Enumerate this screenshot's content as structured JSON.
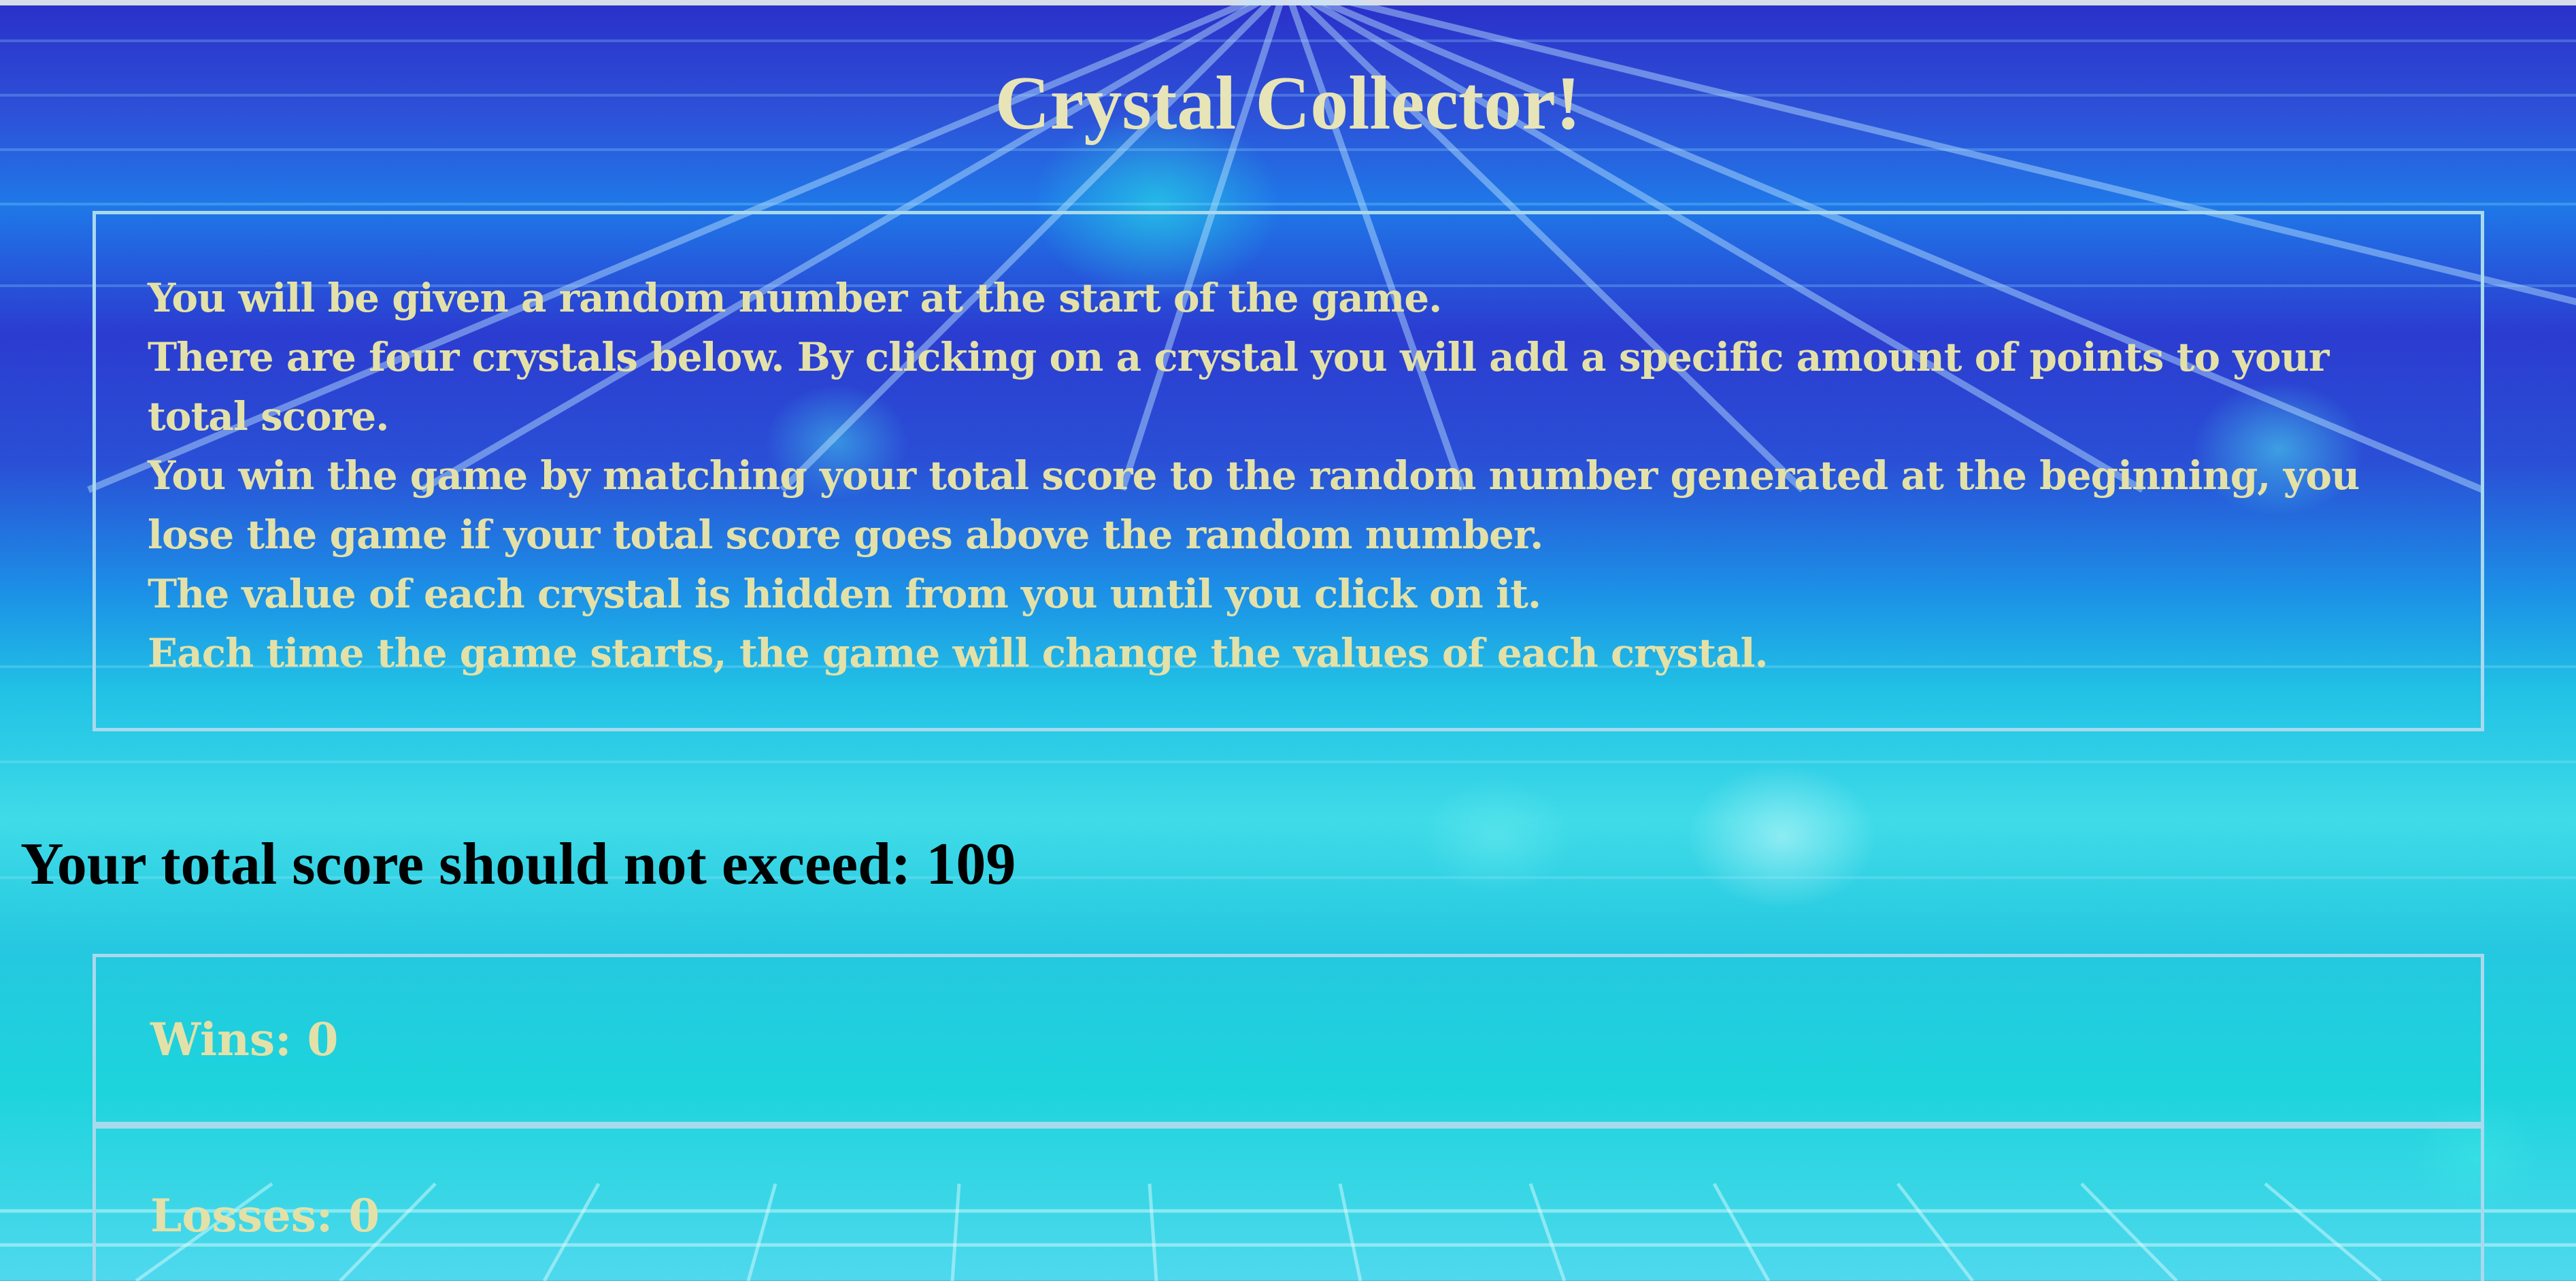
{
  "game": {
    "title": "Crystal Collector!",
    "instructions": [
      "You will be given a random number at the start of the game.",
      "There are four crystals below. By clicking on a crystal you will add a specific amount of points to your",
      "total score.",
      "You win the game by matching your total score to the random number generated at the beginning, you",
      "lose the game if your total score goes above the random number.",
      "The value of each crystal is hidden from you until you click on it.",
      "Each time the game starts, the game will change the values of each crystal."
    ],
    "target_label": "Your total score should not exceed:",
    "target_value": "109",
    "target_text": "Your total score should not exceed: 109",
    "wins_text": "Wins: 0",
    "losses_text": "Losses: 0",
    "wins": 0,
    "losses": 0
  },
  "colors": {
    "title_text": "#e7e4b8",
    "body_text": "#e3e1a8",
    "border": "#a9d9ec",
    "target_text": "#000000"
  }
}
